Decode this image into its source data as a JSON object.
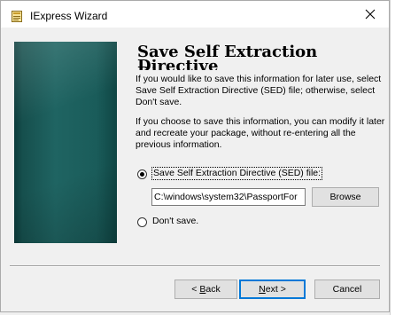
{
  "window": {
    "title": "IExpress Wizard",
    "app_icon": "iexpress-icon",
    "close_icon": "close-icon"
  },
  "banner": {
    "image": "teal-gradient-banner"
  },
  "page": {
    "heading": "Save Self Extraction Directive",
    "heading_overflow_text": "Directive",
    "paragraph1": "If you would like to save this information for later use, select Save Self Extraction Directive (SED) file; otherwise, select Don't save.",
    "paragraph2": "If you choose to save this information, you can modify it later and recreate your package, without re-entering all the previous information."
  },
  "options": {
    "save_sed": {
      "label": "Save Self Extraction Directive (SED) file:",
      "selected": true
    },
    "dont_save": {
      "label": "Don't save.",
      "selected": false
    }
  },
  "sed_path": {
    "value": "C:\\windows\\system32\\PassportFor"
  },
  "buttons": {
    "browse": "Browse",
    "back_prefix": "< ",
    "back_accel": "B",
    "back_rest": "ack",
    "next_accel": "N",
    "next_rest": "ext >",
    "cancel": "Cancel"
  }
}
